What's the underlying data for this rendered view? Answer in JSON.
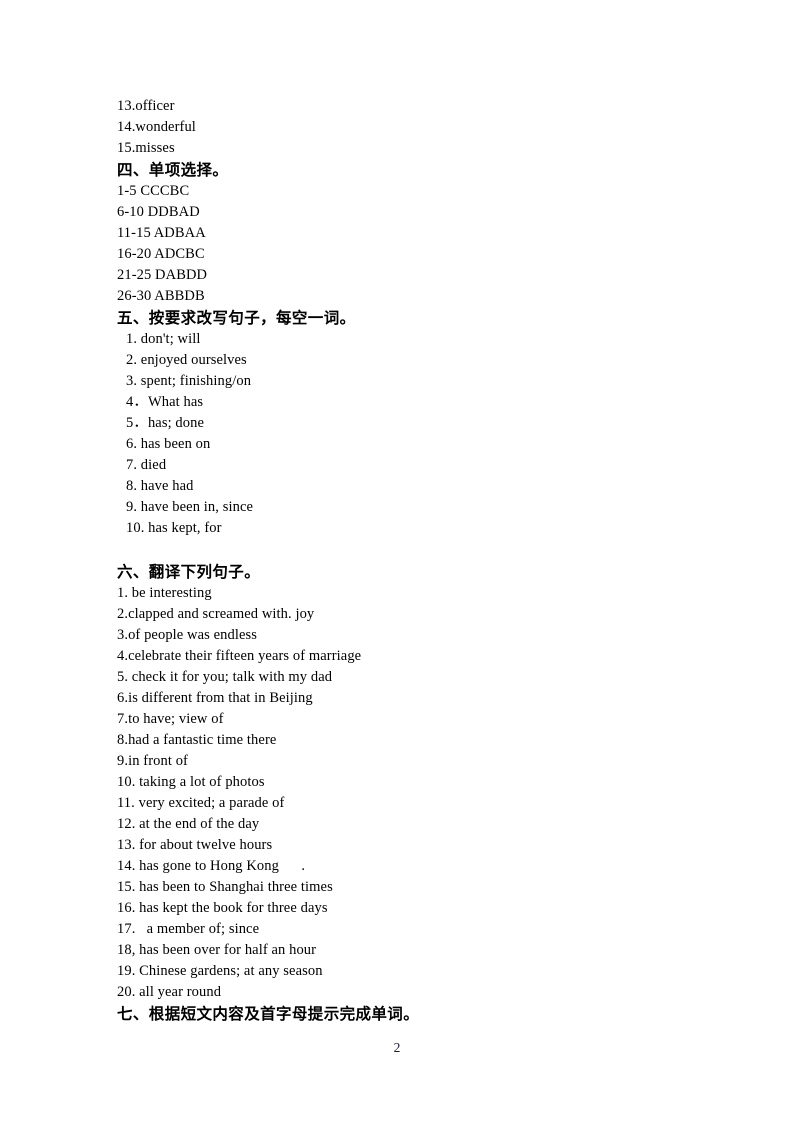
{
  "document": {
    "page_number": "2",
    "blocks": [
      {
        "type": "line",
        "text": "13.officer"
      },
      {
        "type": "line",
        "text": "14.wonderful"
      },
      {
        "type": "line",
        "text": "15.misses"
      },
      {
        "type": "heading",
        "text": "四、单项选择。"
      },
      {
        "type": "line",
        "text": "1-5 CCCBC"
      },
      {
        "type": "line",
        "text": "6-10 DDBAD"
      },
      {
        "type": "line",
        "text": "11-15 ADBAA"
      },
      {
        "type": "line",
        "text": "16-20 ADCBC"
      },
      {
        "type": "line",
        "text": "21-25 DABDD"
      },
      {
        "type": "line",
        "text": "26-30 ABBDB"
      },
      {
        "type": "heading",
        "text": "五、按要求改写句子，每空一词。"
      },
      {
        "type": "indent",
        "text": "1. don't; will"
      },
      {
        "type": "indent",
        "text": "2. enjoyed ourselves"
      },
      {
        "type": "indent",
        "text": "3. spent; finishing/on"
      },
      {
        "type": "indent",
        "text": "4．What has"
      },
      {
        "type": "indent",
        "text": "5．has; done"
      },
      {
        "type": "indent",
        "text": "6. has been on"
      },
      {
        "type": "indent",
        "text": "7. died"
      },
      {
        "type": "indent",
        "text": "8. have had"
      },
      {
        "type": "indent",
        "text": "9. have been in, since"
      },
      {
        "type": "indent",
        "text": "10. has kept, for"
      },
      {
        "type": "spacer",
        "text": ""
      },
      {
        "type": "heading",
        "text": "六、翻译下列句子。"
      },
      {
        "type": "line",
        "text": "1. be interesting"
      },
      {
        "type": "line",
        "text": "2.clapped and screamed with. joy"
      },
      {
        "type": "line",
        "text": "3.of people was endless"
      },
      {
        "type": "line",
        "text": "4.celebrate their fifteen years of marriage"
      },
      {
        "type": "line",
        "text": "5. check it for you; talk with my dad"
      },
      {
        "type": "line",
        "text": "6.is different from that in Beijing"
      },
      {
        "type": "line",
        "text": "7.to have; view of"
      },
      {
        "type": "line",
        "text": "8.had a fantastic time there"
      },
      {
        "type": "line",
        "text": "9.in front of"
      },
      {
        "type": "line",
        "text": "10. taking a lot of photos"
      },
      {
        "type": "line",
        "text": "11. very excited; a parade of"
      },
      {
        "type": "line",
        "text": "12. at the end of the day"
      },
      {
        "type": "line",
        "text": "13. for about twelve hours"
      },
      {
        "type": "line",
        "text": "14. has gone to Hong Kong      ."
      },
      {
        "type": "line",
        "text": "15. has been to Shanghai three times"
      },
      {
        "type": "line",
        "text": "16. has kept the book for three days"
      },
      {
        "type": "line",
        "text": "17.   a member of; since"
      },
      {
        "type": "line",
        "text": "18, has been over for half an hour"
      },
      {
        "type": "line",
        "text": "19. Chinese gardens; at any season"
      },
      {
        "type": "line",
        "text": "20. all year round"
      },
      {
        "type": "heading",
        "text": "七、根据短文内容及首字母提示完成单词。"
      }
    ]
  }
}
